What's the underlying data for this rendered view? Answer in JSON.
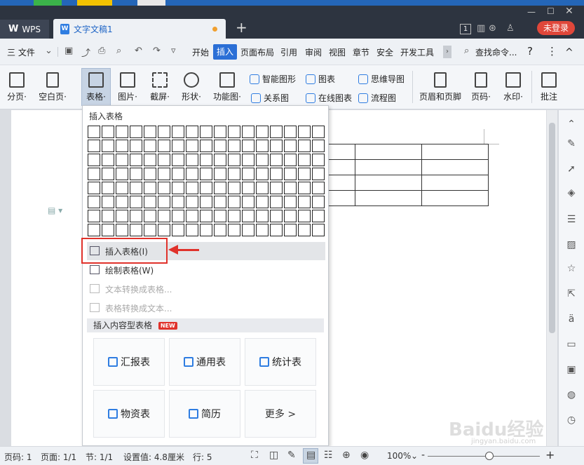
{
  "titlebar": {
    "wps_tab": "WPS",
    "doc_tab": "文字文稿1",
    "new_tab": "+",
    "badge": "1",
    "login": "未登录"
  },
  "menubar": {
    "file": "三 文件",
    "items": [
      "开始",
      "插入",
      "页面布局",
      "引用",
      "审阅",
      "视图",
      "章节",
      "安全",
      "开发工具"
    ],
    "active": "插入",
    "search": "查找命令...",
    "help": "?",
    "more": "⋮",
    "collapse": "^"
  },
  "ribbon": {
    "buttons": [
      "分页·",
      "空白页·",
      "表格·",
      "图片·",
      "截屏·",
      "形状·",
      "功能图·"
    ],
    "small": {
      "smart_shape": "智能图形",
      "chart": "图表",
      "mindmap": "思维导图",
      "relation": "关系图",
      "online_chart": "在线图表",
      "flowchart": "流程图"
    },
    "right_buttons": [
      "页眉和页脚",
      "页码·",
      "水印·",
      "批注"
    ]
  },
  "dropdown": {
    "title": "插入表格",
    "grid_rows": 8,
    "grid_cols": 17,
    "items": [
      {
        "label": "插入表格(I)",
        "enabled": true
      },
      {
        "label": "绘制表格(W)",
        "enabled": true
      },
      {
        "label": "文本转换成表格...",
        "enabled": false
      },
      {
        "label": "表格转换成文本...",
        "enabled": false
      }
    ],
    "section": "插入内容型表格",
    "new_badge": "NEW",
    "templates": [
      "汇报表",
      "通用表",
      "统计表",
      "物资表",
      "简历",
      "更多 >"
    ]
  },
  "statusbar": {
    "page_code": "页码: 1",
    "page": "页面: 1/1",
    "section": "节: 1/1",
    "setting": "设置值: 4.8厘米",
    "row": "行: 5",
    "zoom": "100%",
    "minus": "-",
    "plus": "+"
  },
  "watermark": {
    "brand": "Baidu经验",
    "url": "jingyan.baidu.com"
  },
  "colors": {
    "accent": "#2b6fd6",
    "login": "#e0473a",
    "highlight": "#e0322b"
  }
}
